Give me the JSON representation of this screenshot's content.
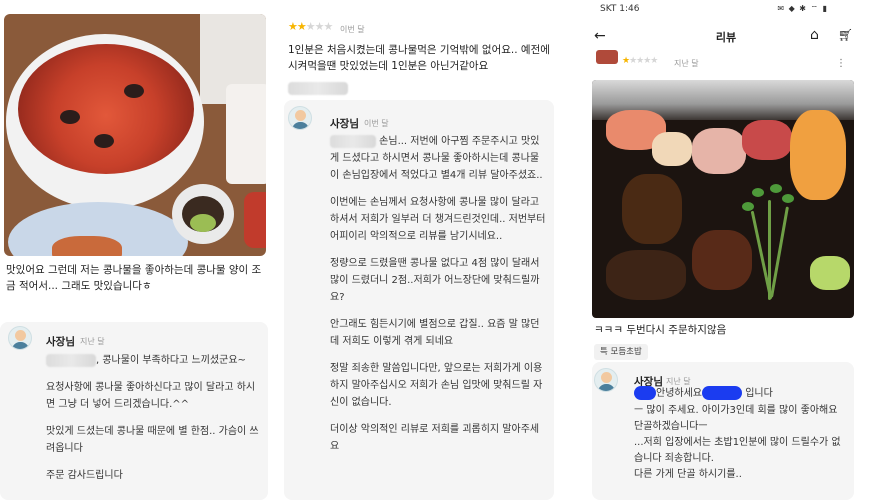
{
  "panel1": {
    "review_text": "맛있어요 그런데 저는 콩나물을 좋아하는데 콩나물 양이 조금 적어서... 그래도 맛있습니다ㅎ",
    "owner_name": "사장님",
    "owner_time": "지난 달",
    "reply": [
      ", 콩나물이 부족하다고 느끼셨군요~",
      "요청사항에 콩나물 좋아하신다고 많이 달라고 하시면 그냥 더 넣어 드리겠습니다.^^",
      "맛있게 드셨는데 콩나물 때문에 별 한점.. 가슴이 쓰려옵니다",
      "주문 감사드립니다"
    ]
  },
  "panel2": {
    "rating": 2,
    "rating_time": "이번 달",
    "review_text": "1인분은 처음시켰는데 콩나물먹은 기억밖에 없어요.. 예전에 시켜먹을땐 맛있었는데 1인분은 아닌거같아요",
    "owner_name": "사장님",
    "owner_time": "이번 달",
    "reply": [
      " 손님... 저번에 아구찜 주문주시고 맛있게 드셨다고 하시면서 콩나물 좋아하시는데 콩나물이 손님입장에서 적었다고 별4개 리뷰 달아주셨죠..",
      "이번에는 손님께서 요청사항에 콩나물 많이 달라고 하셔서 저희가 일부러 더 챙겨드린것인데.. 저번부터 어피이리 악의적으로 리뷰를 남기시네요..",
      "정량으로 드렸을땐 콩나물 없다고 4점 많이 달래서 많이 드렸더니 2점..저희가 어느장단에 맞춰드릴까요?",
      "안그래도 힘든시기에 별점으로 갑질.. 요즘 말 많던데 저희도 이렇게 겪게 되네요",
      "정말 죄송한 말씀입니다만, 앞으로는 저희가게 이용 하지 말아주십시오 저희가 손님 입맛에 맞춰드릴 자신이 없습니다.",
      "더이상 악의적인 리뷰로 저희를 괴롭히지 말아주세요"
    ]
  },
  "panel3": {
    "status": {
      "carrier": "SKT 1:46",
      "icons": "✉ ◆ ✱ ⌔ ▮"
    },
    "title": "리뷰",
    "rating": 1,
    "rating_time": "지난 달",
    "review_text": "ㅋㅋㅋ 두번다시 주문하지않음",
    "tag": "특 모듬초밥",
    "owner_name": "사장님",
    "owner_time": "지난 달",
    "reply": [
      "안녕하세요",
      "입니다",
      "ㅡ 많이 주세요. 아이가3인데 회를 많이 좋아해요 단골하겠습니다ㅡ",
      "...저희 입장에서는 초밥1인분에 많이 드릴수가 없습니다 죄송합니다.",
      "다른 가게 단골 하시기를.."
    ],
    "icons": [
      "back-arrow-icon",
      "home-icon",
      "cart-icon",
      "more-icon"
    ]
  }
}
